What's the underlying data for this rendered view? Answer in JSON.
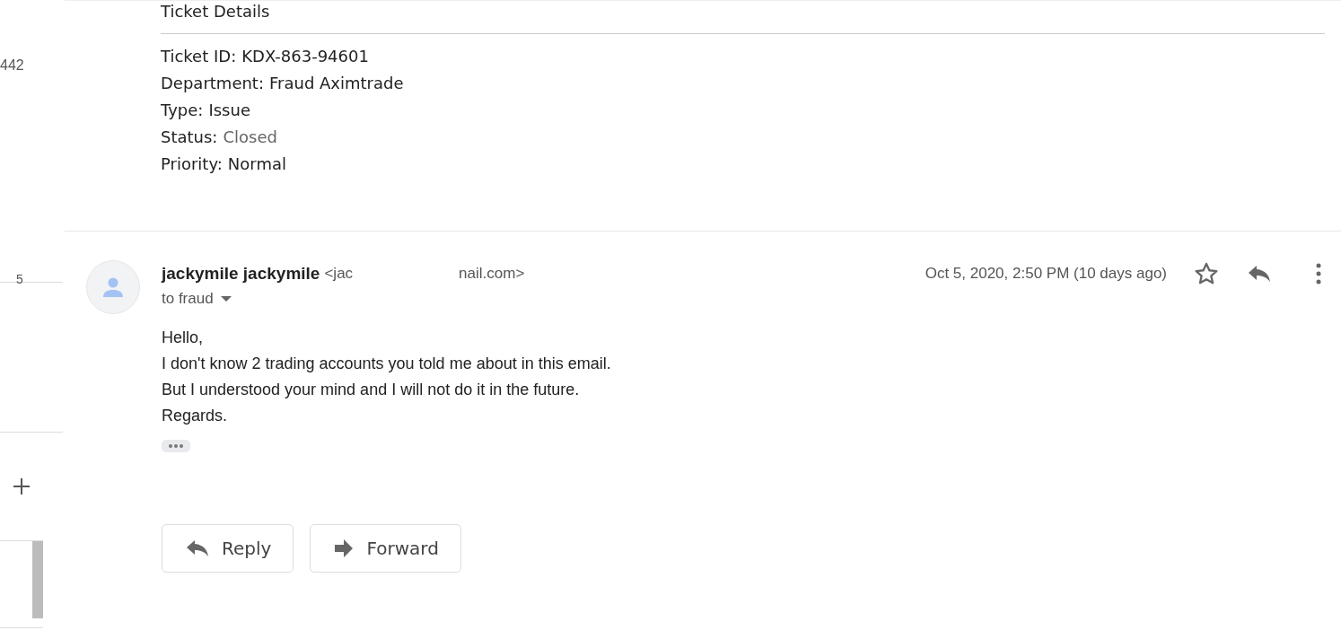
{
  "left_rail": {
    "counts": [
      "442",
      "5"
    ]
  },
  "ticket": {
    "title": "Ticket Details",
    "fields": [
      {
        "label": "Ticket ID:",
        "value": "KDX-863-94601",
        "kind": "plain"
      },
      {
        "label": "Department:",
        "value": "Fraud Aximtrade",
        "kind": "plain"
      },
      {
        "label": "Type:",
        "value": "Issue",
        "kind": "plain"
      },
      {
        "label": "Status:",
        "value": "Closed",
        "kind": "muted"
      },
      {
        "label": "Priority:",
        "value": "Normal",
        "kind": "plain"
      }
    ]
  },
  "message": {
    "sender_name": "jackymile jackymile",
    "sender_email_parts": [
      "<jac",
      "nail.com>"
    ],
    "recipient": "to fraud",
    "date": "Oct 5, 2020, 2:50 PM (10 days ago)",
    "starred": false,
    "body": [
      "Hello,",
      "I don't know 2 trading accounts you told me about in this email.",
      "But I understood your mind and I will not do it in the future.",
      "Regards."
    ]
  },
  "actions": [
    {
      "label": "Reply",
      "kind": "reply"
    },
    {
      "label": "Forward",
      "kind": "forward"
    }
  ]
}
